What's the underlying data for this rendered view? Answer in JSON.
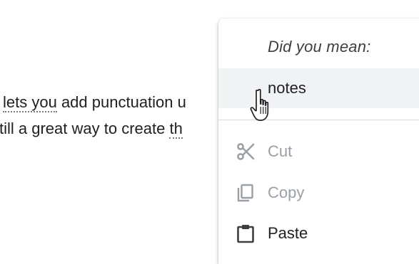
{
  "document": {
    "line1_part1": "lets you",
    "line1_part2": " add punctuation u",
    "line2_part1": "till a great way to create ",
    "line2_part2": "th"
  },
  "context_menu": {
    "heading": "Did you mean:",
    "suggestion": "notes",
    "items": [
      {
        "label": "Cut",
        "icon": "scissors-icon",
        "disabled": true
      },
      {
        "label": "Copy",
        "icon": "copy-icon",
        "disabled": true
      },
      {
        "label": "Paste",
        "icon": "clipboard-icon",
        "disabled": false
      }
    ]
  },
  "colors": {
    "text": "#202124",
    "disabled_text": "#9aa0a6",
    "highlight": "#f1f3f4",
    "separator": "#dadce0"
  }
}
